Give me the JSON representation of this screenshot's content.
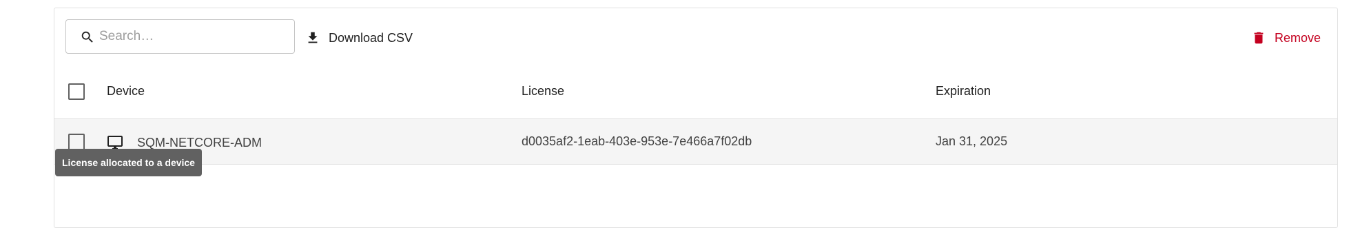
{
  "toolbar": {
    "search_placeholder": "Search…",
    "search_value": "",
    "download_label": "Download CSV",
    "remove_label": "Remove"
  },
  "table": {
    "columns": [
      "Device",
      "License",
      "Expiration"
    ],
    "rows": [
      {
        "device": "SQM-NETCORE-ADM",
        "device_icon": "monitor-icon",
        "license": "d0035af2-1eab-403e-953e-7e466a7f02db",
        "expiration": "Jan 31, 2025",
        "checked": false
      }
    ]
  },
  "tooltip": {
    "text": "License allocated to a device"
  },
  "colors": {
    "remove": "#c4001f",
    "row_highlight": "#f5f5f5",
    "tooltip_bg": "#616161"
  }
}
